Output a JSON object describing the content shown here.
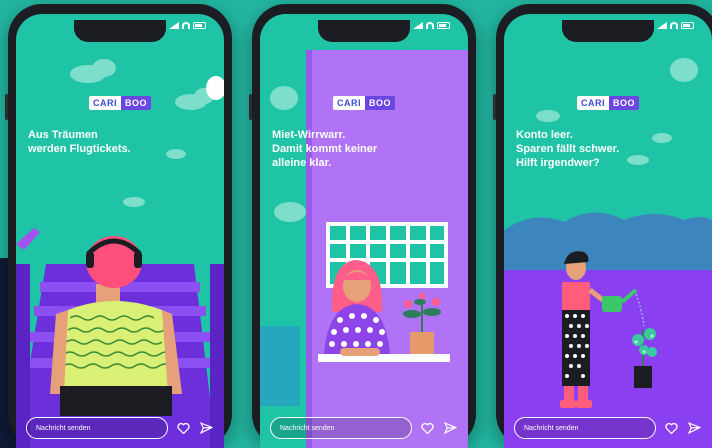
{
  "colors": {
    "background": "#22b5a0",
    "screen_teal": "#1fc3a6",
    "purple": "#7b3ff0",
    "violet_bg": "#b073f5",
    "logo_blue": "#3a4bd1",
    "logo_purple": "#6b46e0",
    "dark_navy": "#0f1a35"
  },
  "brand": {
    "part1": "CARI",
    "part2": "BOO"
  },
  "phones": [
    {
      "caption_lines": [
        "Aus Träumen",
        "werden Flugtickets."
      ],
      "message_placeholder": "Nachricht senden",
      "icons": [
        "heart-icon",
        "send-icon"
      ]
    },
    {
      "caption_lines": [
        "Miet-Wirrwarr.",
        "Damit kommt keiner",
        "alleine klar."
      ],
      "message_placeholder": "Nachricht senden",
      "icons": [
        "heart-icon",
        "send-icon"
      ]
    },
    {
      "caption_lines": [
        "Konto leer.",
        "Sparen fällt schwer.",
        "Hilft irgendwer?"
      ],
      "message_placeholder": "Nachricht senden",
      "icons": [
        "heart-icon",
        "send-icon"
      ]
    }
  ]
}
